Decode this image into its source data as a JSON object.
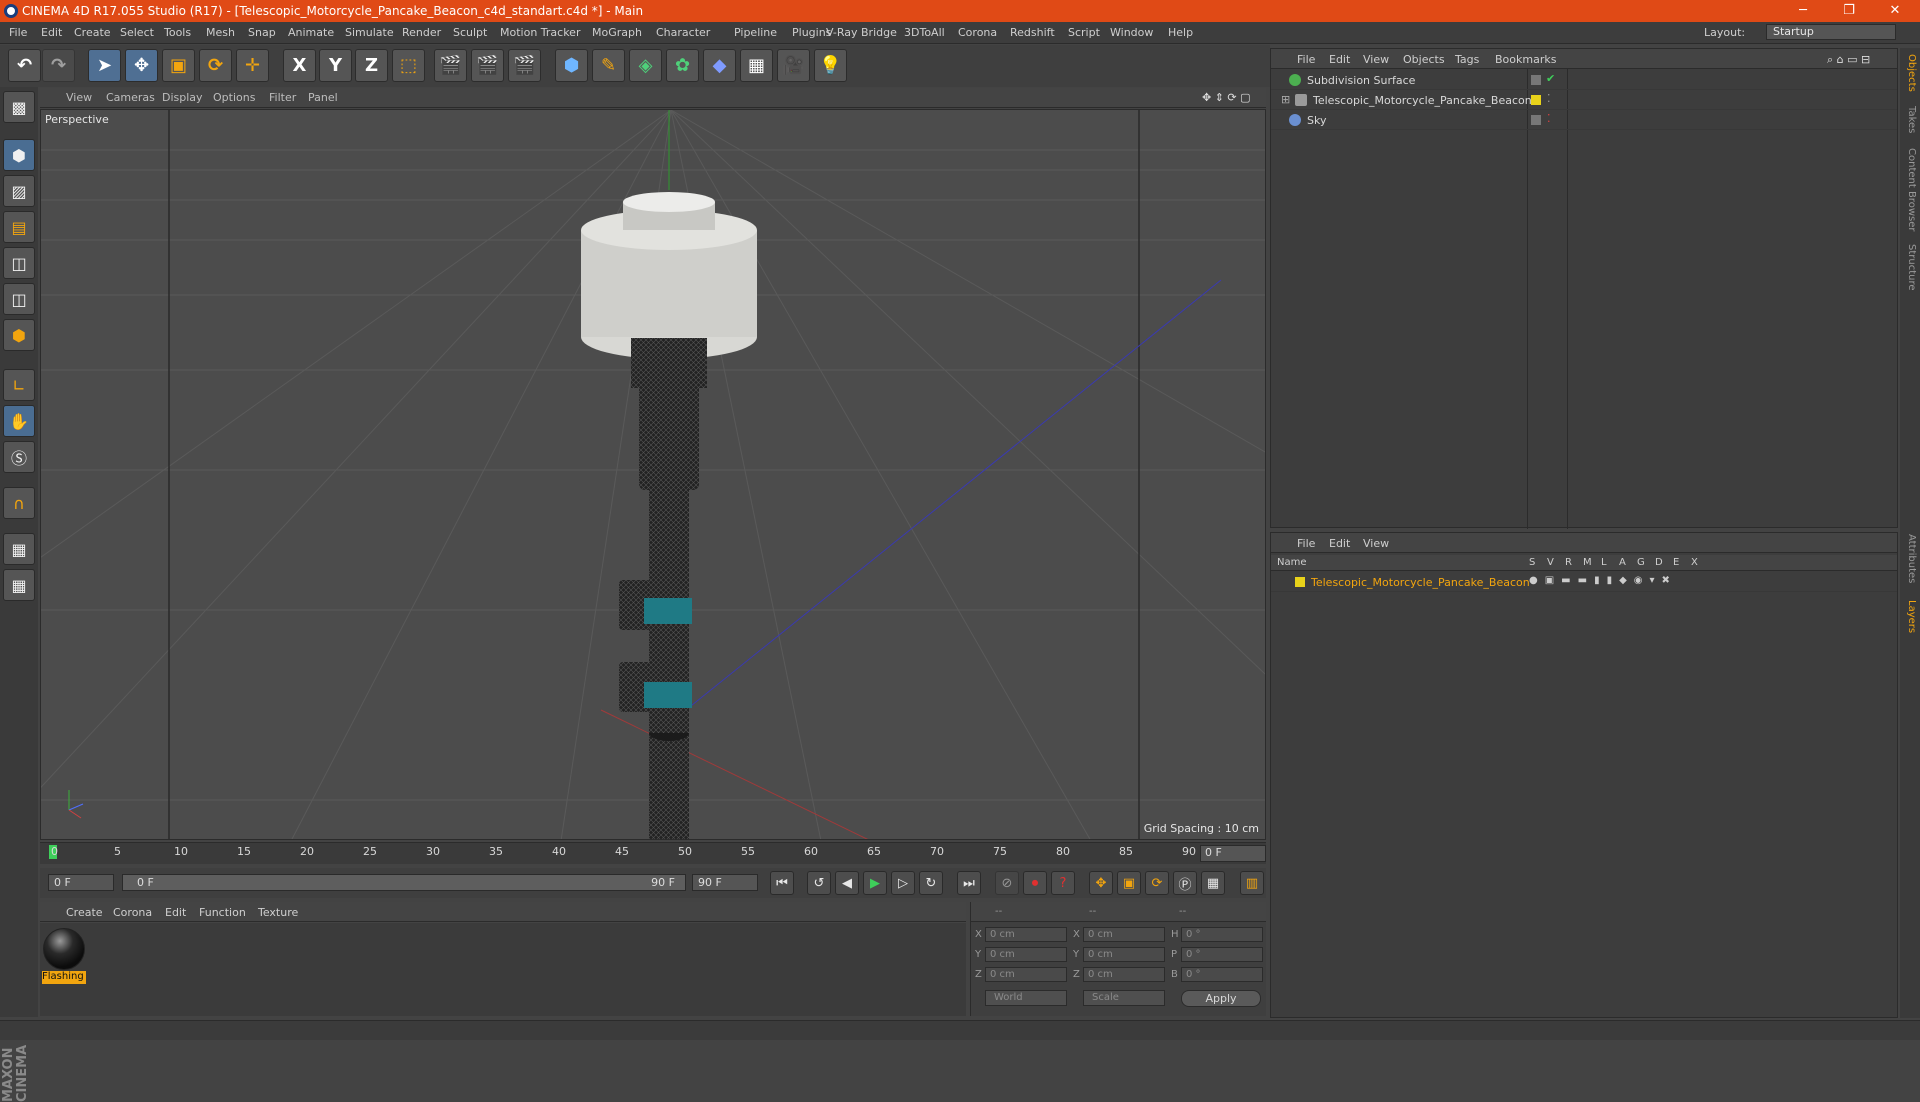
{
  "window": {
    "title": "CINEMA 4D R17.055 Studio (R17) - [Telescopic_Motorcycle_Pancake_Beacon_c4d_standart.c4d *] - Main"
  },
  "menu": [
    "File",
    "Edit",
    "Create",
    "Select",
    "Tools",
    "Mesh",
    "Snap",
    "Animate",
    "Simulate",
    "Render",
    "Sculpt",
    "Motion Tracker",
    "MoGraph",
    "Character",
    "Pipeline",
    "Plugins",
    "V-Ray Bridge",
    "3DToAll",
    "Corona",
    "Redshift",
    "Script",
    "Window",
    "Help"
  ],
  "layout": {
    "label": "Layout:",
    "value": "Startup"
  },
  "toolbar": {
    "axes": [
      "X",
      "Y",
      "Z"
    ]
  },
  "viewport": {
    "menu": [
      "View",
      "Cameras",
      "Display",
      "Options",
      "Filter",
      "Panel"
    ],
    "label": "Perspective",
    "grid_spacing": "Grid Spacing : 10 cm"
  },
  "timeline": {
    "ticks": [
      "0",
      "5",
      "10",
      "15",
      "20",
      "25",
      "30",
      "35",
      "40",
      "45",
      "50",
      "55",
      "60",
      "65",
      "70",
      "75",
      "80",
      "85",
      "90"
    ],
    "current_frame": "0 F"
  },
  "transport": {
    "start": "0 F",
    "range_start": "0 F",
    "range_end": "90 F",
    "end": "90 F"
  },
  "material_manager": {
    "menu": [
      "Create",
      "Corona",
      "Edit",
      "Function",
      "Texture"
    ],
    "material_name": "Flashing"
  },
  "coordinates": {
    "header": [
      "--",
      "--",
      "--"
    ],
    "rows": [
      {
        "a": "X",
        "av": "0 cm",
        "b": "X",
        "bv": "0 cm",
        "c": "H",
        "cv": "0 °"
      },
      {
        "a": "Y",
        "av": "0 cm",
        "b": "Y",
        "bv": "0 cm",
        "c": "P",
        "cv": "0 °"
      },
      {
        "a": "Z",
        "av": "0 cm",
        "b": "Z",
        "bv": "0 cm",
        "c": "B",
        "cv": "0 °"
      }
    ],
    "mode": "World",
    "transform": "Scale",
    "apply": "Apply"
  },
  "object_manager": {
    "menu": [
      "File",
      "Edit",
      "View",
      "Objects",
      "Tags",
      "Bookmarks"
    ],
    "objects": [
      {
        "name": "Subdivision Surface",
        "icon_color": "#4caf50"
      },
      {
        "name": "Telescopic_Motorcycle_Pancake_Beacon",
        "icon_color": "#aaaaaa",
        "tag_color": "#e8d21a"
      },
      {
        "name": "Sky",
        "icon_color": "#6a8fd0"
      }
    ]
  },
  "layer_manager": {
    "menu": [
      "File",
      "Edit",
      "View"
    ],
    "columns": [
      "Name",
      "S",
      "V",
      "R",
      "M",
      "L",
      "A",
      "G",
      "D",
      "E",
      "X"
    ],
    "layer": {
      "name": "Telescopic_Motorcycle_Pancake_Beacon",
      "color": "#e8d21a"
    }
  },
  "right_tabs": [
    "Objects",
    "Takes",
    "Content Browser",
    "Structure",
    "Attributes",
    "Layers"
  ],
  "branding": "MAXON CINEMA 4D"
}
